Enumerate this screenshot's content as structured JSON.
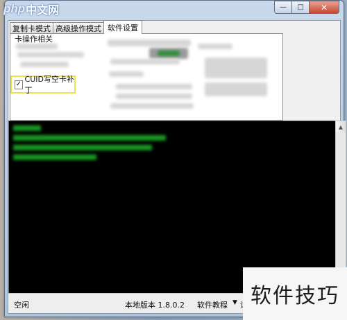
{
  "window": {
    "logo_php": "php",
    "logo_cn": "中文网",
    "min_symbol": "—",
    "max_symbol": "□",
    "close_symbol": "✕"
  },
  "tabs": [
    {
      "label": "复制卡模式"
    },
    {
      "label": "高级操作模式"
    },
    {
      "label": "软件设置",
      "active": true
    }
  ],
  "settings": {
    "group_title": "卡操作相关",
    "cuid_checkbox_label": "CUID写空卡补丁",
    "cuid_checked": true
  },
  "status": {
    "state": "空闲",
    "version": "本地版本 1.8.0.2",
    "tutorial": "软件教程",
    "dropdown_symbol": "▼",
    "settings_partial": "设"
  },
  "watermark": "软件技巧",
  "colors": {
    "console_bg": "#000000",
    "console_text": "#1fbf2a",
    "highlight_border": "#e8e64a"
  }
}
